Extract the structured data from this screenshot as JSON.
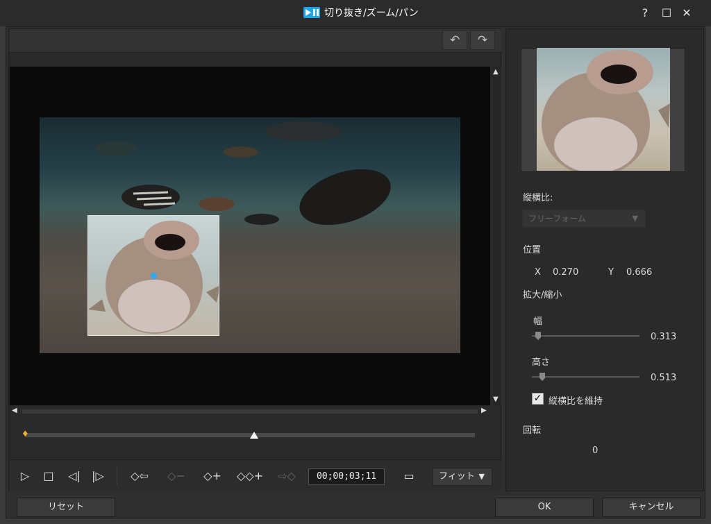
{
  "window": {
    "title": "切り抜き/ズーム/パン",
    "help": "?",
    "maximize": "☐",
    "close": "✕"
  },
  "toolbar": {
    "undo": "↶",
    "redo": "↷"
  },
  "timeline": {
    "start_marker": "♦",
    "playhead_fraction": 0.51
  },
  "controls": {
    "play": "▷",
    "stop": "□",
    "prev_frame": "◁|",
    "next_frame": "|▷",
    "keyframe_prev": "◇⇦",
    "keyframe_remove": "◇−",
    "keyframe_add": "◇+",
    "keyframe_dup": "◇◇+",
    "keyframe_next": "⇨◇",
    "timecode": "00;00;03;11",
    "safe_area": "▭",
    "fit_label": "フィット",
    "caret": "▼"
  },
  "settings": {
    "aspect_label": "縦横比:",
    "aspect_value": "フリーフォーム",
    "position_label": "位置",
    "x_label": "X",
    "x_value": "0.270",
    "y_label": "Y",
    "y_value": "0.666",
    "scale_label": "拡大/縮小",
    "width_label": "幅",
    "width_value": "0.313",
    "height_label": "高さ",
    "height_value": "0.513",
    "keep_aspect_label": "縦横比を維持",
    "keep_aspect_checked": true,
    "rotation_label": "回転",
    "rotation_value": "0"
  },
  "buttons": {
    "reset": "リセット",
    "ok": "OK",
    "cancel": "キャンセル"
  },
  "colors": {
    "accent": "#2ea8f0",
    "keyframe": "#f0b030"
  }
}
